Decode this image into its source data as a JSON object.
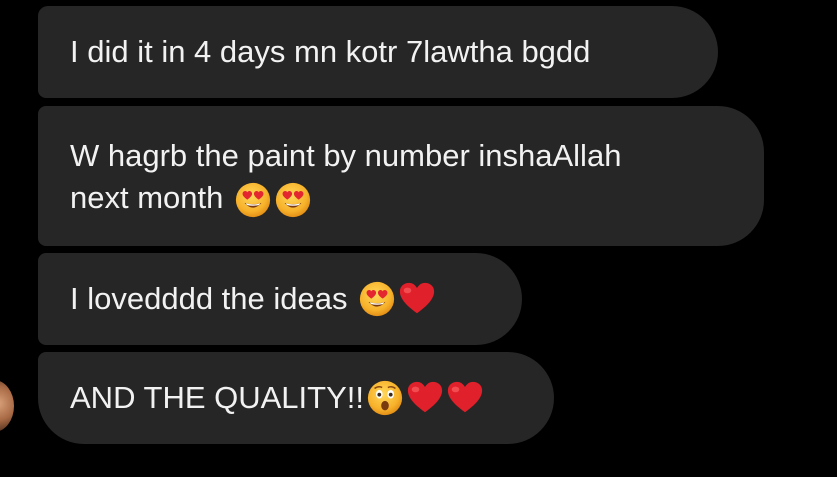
{
  "messages": [
    {
      "text": "I did it in 4 days mn kotr 7lawtha bgdd",
      "emojis": []
    },
    {
      "line1": "W hagrb the paint by number inshaAllah",
      "line2": "next month",
      "emojis": [
        "heart-eyes-emoji",
        "heart-eyes-emoji"
      ]
    },
    {
      "text": "I lovedddd the ideas",
      "emojis": [
        "heart-eyes-emoji",
        "red-heart-emoji"
      ]
    },
    {
      "text": "AND THE QUALITY!!",
      "emojis": [
        "astonished-emoji",
        "red-heart-emoji",
        "red-heart-emoji"
      ]
    }
  ],
  "colors": {
    "background": "#000000",
    "bubble": "#262626",
    "text": "#f2f2f2",
    "heart": "#e0202a",
    "emoji_face": "#f7b92f"
  }
}
